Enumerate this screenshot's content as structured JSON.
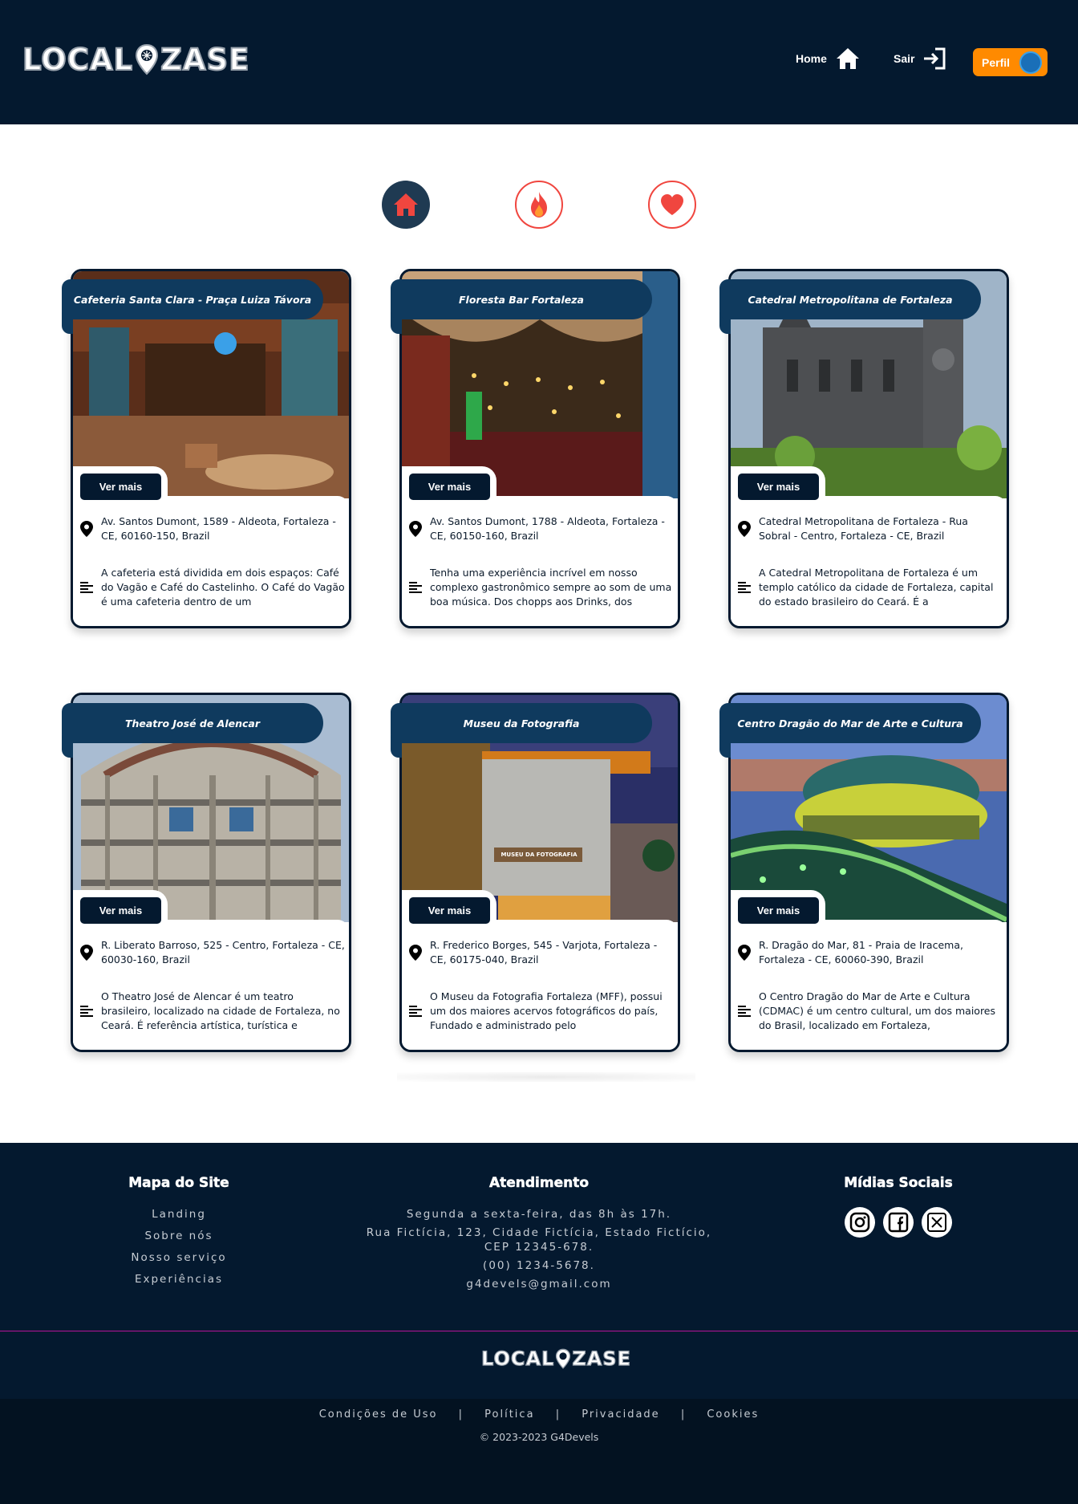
{
  "header": {
    "logo": "LOCAL ZASE",
    "nav": {
      "home": "Home",
      "sair": "Sair",
      "perfil": "Perfil"
    }
  },
  "filters": [
    {
      "icon": "home-icon",
      "active": true
    },
    {
      "icon": "fire-icon",
      "active": false
    },
    {
      "icon": "heart-icon",
      "active": false
    }
  ],
  "cards": [
    {
      "title": "Cafeteria Santa Clara - Praça Luiza Távora",
      "button": "Ver mais",
      "address": "Av. Santos Dumont, 1589 - Aldeota, Fortaleza - CE, 60160-150, Brazil",
      "description": "A cafeteria está dividida em dois espaços: Café do Vagão e Café do Castelinho. O Café do Vagão é uma cafeteria dentro de um"
    },
    {
      "title": "Floresta Bar Fortaleza",
      "button": "Ver mais",
      "address": "Av. Santos Dumont, 1788 - Aldeota, Fortaleza - CE, 60150-160, Brazil",
      "description": "Tenha uma experiência incrível em nosso complexo gastronômico sempre ao som de uma boa música. Dos chopps aos Drinks, dos"
    },
    {
      "title": "Catedral Metropolitana de Fortaleza",
      "button": "Ver mais",
      "address": "Catedral Metropolitana de Fortaleza - Rua Sobral - Centro, Fortaleza - CE, Brazil",
      "description": "A Catedral Metropolitana de Fortaleza é um templo católico da cidade de Fortaleza, capital do estado brasileiro do Ceará. É a"
    },
    {
      "title": "Theatro José de Alencar",
      "button": "Ver mais",
      "address": "R. Liberato Barroso, 525 - Centro, Fortaleza - CE, 60030-160, Brazil",
      "description": "O Theatro José de Alencar é um teatro brasileiro, localizado na cidade de Fortaleza, no Ceará. É referência artística, turística e"
    },
    {
      "title": "Museu da Fotografia",
      "button": "Ver mais",
      "address": "R. Frederico Borges, 545 - Varjota, Fortaleza - CE, 60175-040, Brazil",
      "description": "O Museu da Fotografia Fortaleza (MFF), possui um dos maiores acervos fotográficos do país, Fundado e administrado pelo"
    },
    {
      "title": "Centro Dragão do Mar de Arte e Cultura",
      "button": "Ver mais",
      "address": "R. Dragão do Mar, 81 - Praia de Iracema, Fortaleza - CE, 60060-390, Brazil",
      "description": "O Centro Dragão do Mar de Arte e Cultura (CDMAC) é um centro cultural, um dos maiores do Brasil, localizado em Fortaleza,"
    }
  ],
  "footer": {
    "mapa": {
      "title": "Mapa do Site",
      "links": [
        "Landing",
        "Sobre nós",
        "Nosso serviço",
        "Experiências"
      ]
    },
    "atendimento": {
      "title": "Atendimento",
      "hours": "Segunda a sexta-feira, das 8h às 17h.",
      "address": "Rua Fictícia, 123, Cidade Fictícia, Estado Fictício, CEP 12345-678.",
      "phone": "(00) 1234-5678.",
      "email": "g4devels@gmail.com"
    },
    "midias": {
      "title": "Mídias Sociais",
      "icons": [
        "instagram-icon",
        "facebook-icon",
        "x-twitter-icon"
      ]
    },
    "logo": "LOCAL ZASE",
    "legal": [
      "Condições de Uso",
      "Política",
      "Privacidade",
      "Cookies"
    ],
    "separator": "|",
    "copyright": "© 2023-2023 G4Devels"
  },
  "colors": {
    "navy": "#04192f",
    "card_title": "#0f3a5e",
    "accent_orange": "#ff8a00",
    "accent_red": "#f0463f",
    "divider_magenta": "#b8129a"
  }
}
